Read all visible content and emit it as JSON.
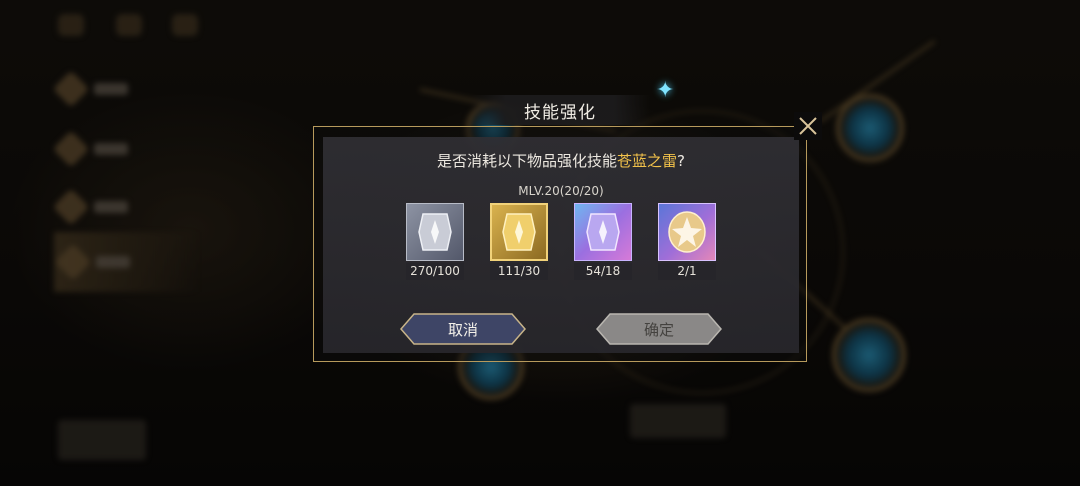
{
  "dialog": {
    "title": "技能强化",
    "question_prefix": "是否消耗以下物品强化技能",
    "skill_name": "苍蓝之雷",
    "question_suffix": "?",
    "mlv": "MLV.20(20/20)",
    "items": [
      {
        "icon": "silver-crystal-icon",
        "count": "270/100"
      },
      {
        "icon": "gold-crystal-icon",
        "count": "111/30"
      },
      {
        "icon": "prismatic-crystal-icon",
        "count": "54/18"
      },
      {
        "icon": "star-emblem-icon",
        "count": "2/1"
      }
    ],
    "cancel_label": "取消",
    "confirm_label": "确定"
  },
  "colors": {
    "frame_gold": "#b79a5c",
    "highlight": "#f2c24a",
    "cancel_fill": "#3e4566",
    "confirm_fill": "#8a8887"
  }
}
